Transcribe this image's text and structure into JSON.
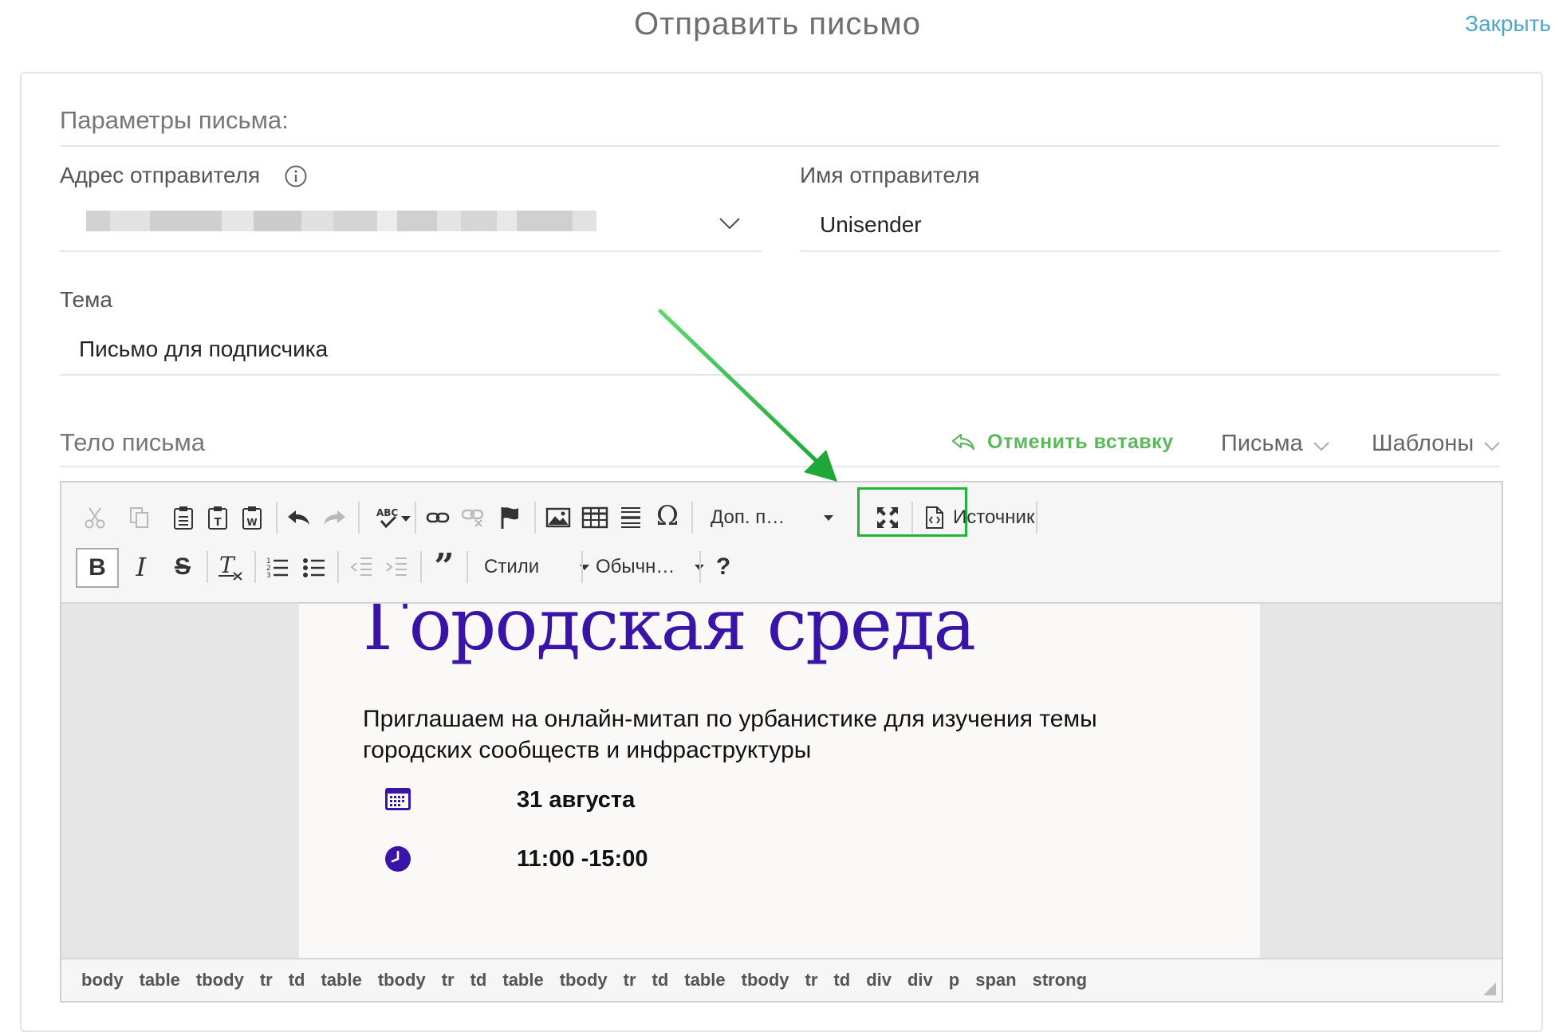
{
  "header": {
    "title": "Отправить письмо",
    "close_label": "Закрыть"
  },
  "params": {
    "section_title": "Параметры письма:",
    "sender_address": {
      "label": "Адрес отправителя",
      "value": ""
    },
    "sender_name": {
      "label": "Имя отправителя",
      "value": "Unisender"
    },
    "subject": {
      "label": "Тема",
      "value": "Письмо для подписчика"
    }
  },
  "body_section": {
    "title": "Тело письма",
    "undo_paste_label": "Отменить вставку",
    "letters_label": "Письма",
    "templates_label": "Шаблоны"
  },
  "toolbar": {
    "extra_combo": "Доп. п…",
    "source_label": "Источник",
    "styles_combo": "Стили",
    "format_combo": "Обычн…",
    "help": "?"
  },
  "content": {
    "title": "Городская среда",
    "intro": "Приглашаем на онлайн-митап по урбанистике для изучения темы городских сообществ и инфраструктуры",
    "date": "31 августа",
    "time": "11:00 -15:00"
  },
  "path": [
    "body",
    "table",
    "tbody",
    "tr",
    "td",
    "table",
    "tbody",
    "tr",
    "td",
    "table",
    "tbody",
    "tr",
    "td",
    "table",
    "tbody",
    "tr",
    "td",
    "div",
    "div",
    "p",
    "span",
    "strong"
  ],
  "colors": {
    "accent_link": "#4aa8c8",
    "undo_green": "#5cb85c",
    "highlight": "#22b33c",
    "brand_purple": "#3a14a8"
  }
}
